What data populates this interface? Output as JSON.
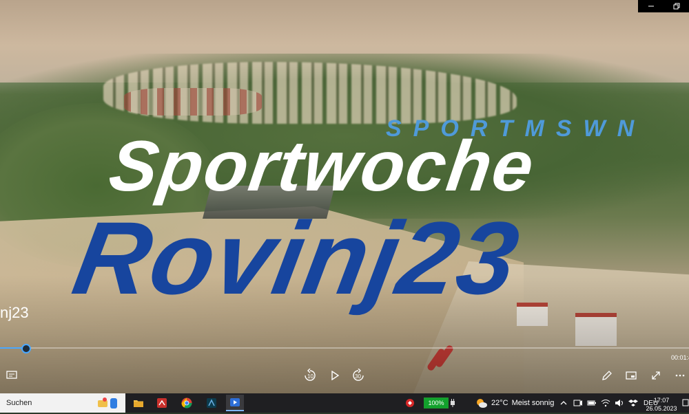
{
  "video": {
    "brand": "SPORTMSWN",
    "title_line1": "Sportwoche",
    "title_line2": "Rovinj23",
    "side_label": "nj23",
    "elapsed_time": "00:01:4",
    "progress": 0.038
  },
  "taskbar": {
    "search_placeholder": "Suchen",
    "battery_percent": "100%",
    "weather_temp": "22°C",
    "weather_text": "Meist sonnig",
    "language": "DEU",
    "time": "17:07",
    "date": "26.05.2023"
  },
  "controls": {
    "skip_back_seconds": "10",
    "skip_forward_seconds": "30"
  },
  "colors": {
    "accent": "#4aa8ff",
    "title_white": "#ffffff",
    "title_blue": "#17459e",
    "brand_blue": "#4f9ad9"
  }
}
